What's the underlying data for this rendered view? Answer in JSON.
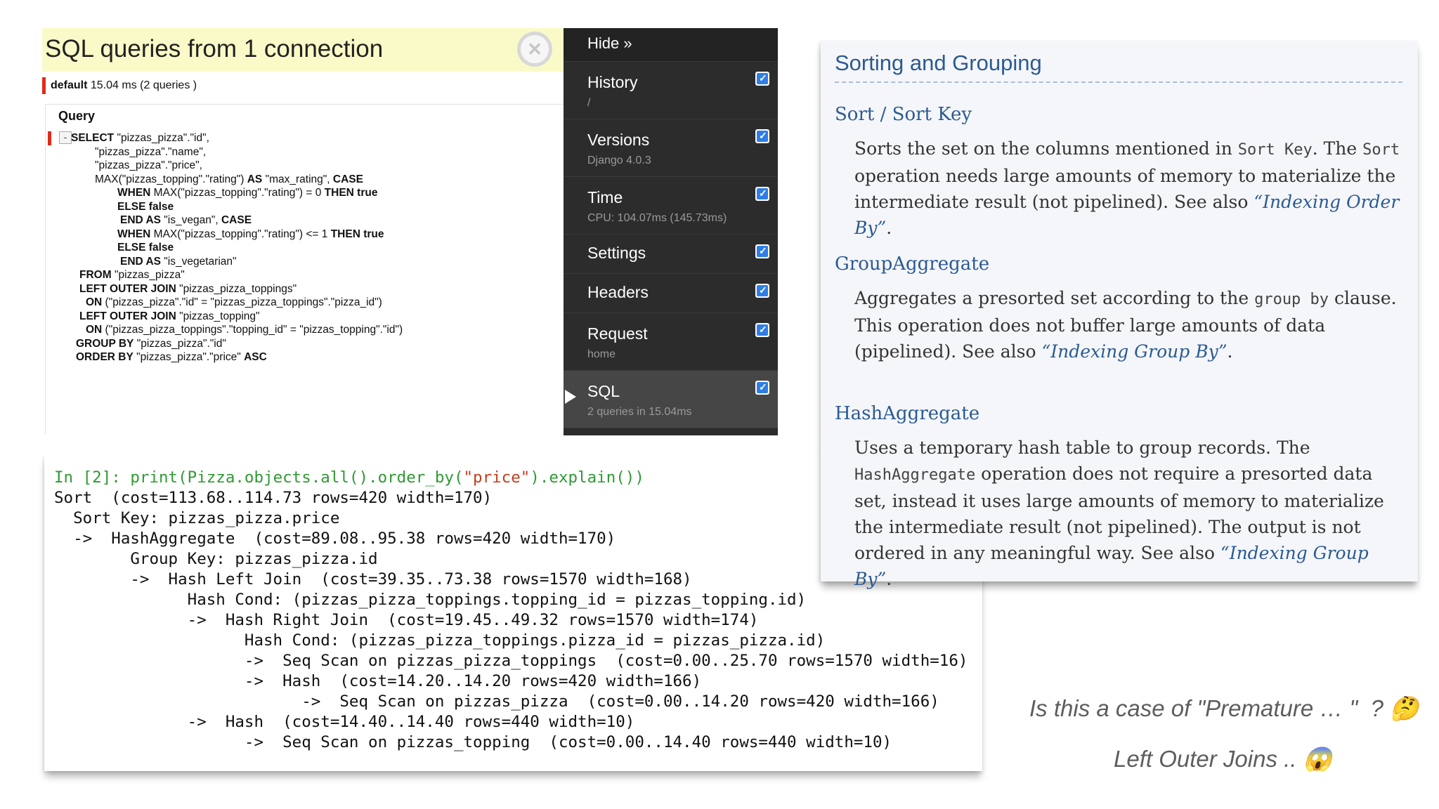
{
  "sql_panel": {
    "title": "SQL queries from 1 connection",
    "close_glyph": "✕",
    "connection_alias": "default",
    "connection_stats": "15.04 ms (2 queries )",
    "query_label": "Query",
    "toggle_glyph": "-",
    "query_lines": [
      [
        {
          "t": "SELECT",
          "b": true
        },
        {
          "t": " \"pizzas_pizza\".\"id\","
        }
      ],
      [
        {
          "t": "\"pizzas_pizza\".\"name\","
        }
      ],
      [
        {
          "t": "\"pizzas_pizza\".\"price\","
        }
      ],
      [
        {
          "t": "MAX(\"pizzas_topping\".\"rating\") "
        },
        {
          "t": "AS",
          "b": true
        },
        {
          "t": " \"max_rating\", "
        },
        {
          "t": "CASE",
          "b": true
        }
      ],
      [
        {
          "t": "WHEN",
          "b": true
        },
        {
          "t": " MAX(\"pizzas_topping\".\"rating\") = 0 "
        },
        {
          "t": "THEN true",
          "b": true
        }
      ],
      [
        {
          "t": "ELSE false",
          "b": true
        }
      ],
      [
        {
          "t": "END AS",
          "b": true
        },
        {
          "t": " \"is_vegan\", "
        },
        {
          "t": "CASE",
          "b": true
        }
      ],
      [
        {
          "t": "WHEN",
          "b": true
        },
        {
          "t": " MAX(\"pizzas_topping\".\"rating\") <= 1 "
        },
        {
          "t": "THEN true",
          "b": true
        }
      ],
      [
        {
          "t": "ELSE false",
          "b": true
        }
      ],
      [
        {
          "t": "END AS",
          "b": true
        },
        {
          "t": " \"is_vegetarian\""
        }
      ],
      [
        {
          "t": "FROM",
          "b": true
        },
        {
          "t": " \"pizzas_pizza\""
        }
      ],
      [
        {
          "t": "LEFT OUTER JOIN",
          "b": true
        },
        {
          "t": " \"pizzas_pizza_toppings\""
        }
      ],
      [
        {
          "t": "ON",
          "b": true
        },
        {
          "t": " (\"pizzas_pizza\".\"id\" = \"pizzas_pizza_toppings\".\"pizza_id\")"
        }
      ],
      [
        {
          "t": "LEFT OUTER JOIN",
          "b": true
        },
        {
          "t": " \"pizzas_topping\""
        }
      ],
      [
        {
          "t": "ON",
          "b": true
        },
        {
          "t": " (\"pizzas_pizza_toppings\".\"topping_id\" = \"pizzas_topping\".\"id\")"
        }
      ],
      [
        {
          "t": "GROUP BY",
          "b": true
        },
        {
          "t": " \"pizzas_pizza\".\"id\""
        }
      ],
      [
        {
          "t": "ORDER BY",
          "b": true
        },
        {
          "t": " \"pizzas_pizza\".\"price\" "
        },
        {
          "t": "ASC",
          "b": true
        }
      ]
    ]
  },
  "toolbar": {
    "hide_label": "Hide »",
    "check_glyph": "✓",
    "items": [
      {
        "id": "history",
        "title": "History",
        "subtitle": "/",
        "checked": true
      },
      {
        "id": "versions",
        "title": "Versions",
        "subtitle": "Django 4.0.3",
        "checked": true
      },
      {
        "id": "time",
        "title": "Time",
        "subtitle": "CPU: 104.07ms (145.73ms)",
        "checked": true
      },
      {
        "id": "settings",
        "title": "Settings",
        "subtitle": "",
        "checked": true
      },
      {
        "id": "headers",
        "title": "Headers",
        "subtitle": "",
        "checked": true
      },
      {
        "id": "request",
        "title": "Request",
        "subtitle": "home",
        "checked": true
      },
      {
        "id": "sql",
        "title": "SQL",
        "subtitle": "2 queries in 15.04ms",
        "checked": true,
        "active": true
      }
    ]
  },
  "terminal": {
    "prompt": "In [2]: ",
    "command_prefix": "print(Pizza.objects.all().order_by(",
    "command_string": "\"price\"",
    "command_suffix": ").explain())",
    "lines": [
      "Sort  (cost=113.68..114.73 rows=420 width=170)",
      "  Sort Key: pizzas_pizza.price",
      "  ->  HashAggregate  (cost=89.08..95.38 rows=420 width=170)",
      "        Group Key: pizzas_pizza.id",
      "        ->  Hash Left Join  (cost=39.35..73.38 rows=1570 width=168)",
      "              Hash Cond: (pizzas_pizza_toppings.topping_id = pizzas_topping.id)",
      "              ->  Hash Right Join  (cost=19.45..49.32 rows=1570 width=174)",
      "                    Hash Cond: (pizzas_pizza_toppings.pizza_id = pizzas_pizza.id)",
      "                    ->  Seq Scan on pizzas_pizza_toppings  (cost=0.00..25.70 rows=1570 width=16)",
      "                    ->  Hash  (cost=14.20..14.20 rows=420 width=166)",
      "                          ->  Seq Scan on pizzas_pizza  (cost=0.00..14.20 rows=420 width=166)",
      "              ->  Hash  (cost=14.40..14.40 rows=440 width=10)",
      "                    ->  Seq Scan on pizzas_topping  (cost=0.00..14.40 rows=440 width=10)"
    ]
  },
  "docs": {
    "title": "Sorting and Grouping",
    "sections": [
      {
        "heading": "Sort / Sort Key",
        "body": [
          {
            "t": "Sorts the set on the columns mentioned in "
          },
          {
            "c": "Sort Key"
          },
          {
            "t": ". The "
          },
          {
            "c": "Sort"
          },
          {
            "t": " operation needs large amounts of memory to materialize the intermediate result (not pipelined). See also "
          },
          {
            "a": "“Indexing Order By”"
          },
          {
            "t": "."
          }
        ]
      },
      {
        "heading": "GroupAggregate",
        "body": [
          {
            "t": "Aggregates a presorted set according to the "
          },
          {
            "c": "group by"
          },
          {
            "t": " clause. This operation does not buffer large amounts of data (pipelined). See also "
          },
          {
            "a": "“Indexing Group By”"
          },
          {
            "t": "."
          }
        ]
      },
      {
        "heading": "HashAggregate",
        "body": [
          {
            "t": "Uses a temporary hash table to group records. The "
          },
          {
            "c": "HashAggregate"
          },
          {
            "t": " operation does not require a presorted data set, instead it uses large amounts of memory to materialize the intermediate result (not pipelined). The output is not ordered in any meaningful way. See also "
          },
          {
            "a": "“Indexing Group By”"
          },
          {
            "t": "."
          }
        ]
      }
    ]
  },
  "captions": {
    "line1": "Is this a case of \"Premature … \"  ? 🤔",
    "line2": "Left Outer Joins .. 😱"
  }
}
